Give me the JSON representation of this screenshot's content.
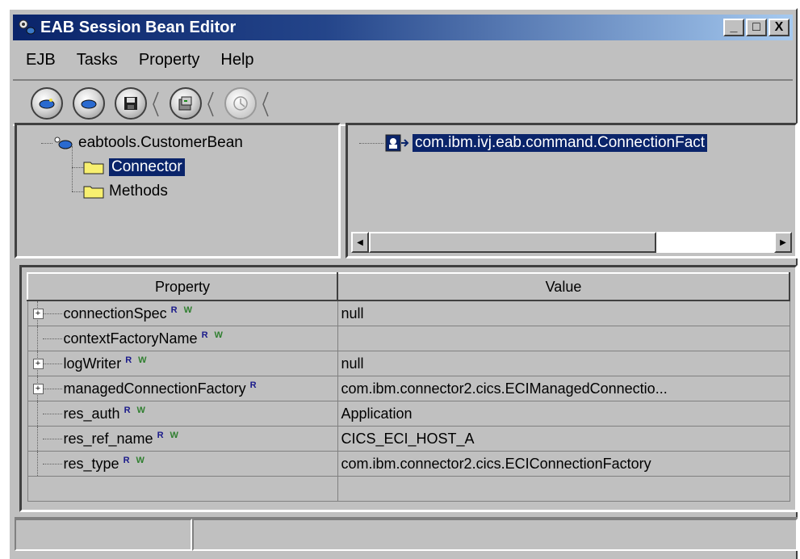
{
  "window": {
    "title": "EAB Session Bean Editor",
    "controls": [
      "_",
      "□",
      "X"
    ]
  },
  "menu": [
    {
      "label": "EJB"
    },
    {
      "label": "Tasks"
    },
    {
      "label": "Property"
    },
    {
      "label": "Help"
    }
  ],
  "toolbar": {
    "buttons": [
      "new-bean-icon",
      "open-bean-icon",
      "save-icon",
      "generate-icon",
      "deploy-icon"
    ]
  },
  "tree": {
    "root": "eabtools.CustomerBean",
    "children": [
      "Connector",
      "Methods"
    ],
    "selected": "Connector"
  },
  "right_panel": {
    "item": "com.ibm.ivj.eab.command.ConnectionFact"
  },
  "properties": {
    "headers": [
      "Property",
      "Value"
    ],
    "rows": [
      {
        "name": "connectionSpec",
        "value": "null",
        "expandable": true,
        "flags": [
          "R",
          "W"
        ]
      },
      {
        "name": "contextFactoryName",
        "value": "",
        "expandable": false,
        "flags": [
          "R",
          "W"
        ]
      },
      {
        "name": "logWriter",
        "value": "null",
        "expandable": true,
        "flags": [
          "R",
          "W"
        ]
      },
      {
        "name": "managedConnectionFactory",
        "value": "com.ibm.connector2.cics.ECIManagedConnectio...",
        "expandable": true,
        "flags": [
          "R"
        ]
      },
      {
        "name": "res_auth",
        "value": "Application",
        "expandable": false,
        "flags": [
          "R",
          "W"
        ]
      },
      {
        "name": "res_ref_name",
        "value": "CICS_ECI_HOST_A",
        "expandable": false,
        "flags": [
          "R",
          "W"
        ]
      },
      {
        "name": "res_type",
        "value": "com.ibm.connector2.cics.ECIConnectionFactory",
        "expandable": false,
        "flags": [
          "R",
          "W"
        ]
      }
    ]
  },
  "colors": {
    "title_gradient_start": "#0a246a",
    "title_gradient_end": "#a6caf0",
    "selection": "#0a246a",
    "window_bg": "#c0c0c0"
  }
}
